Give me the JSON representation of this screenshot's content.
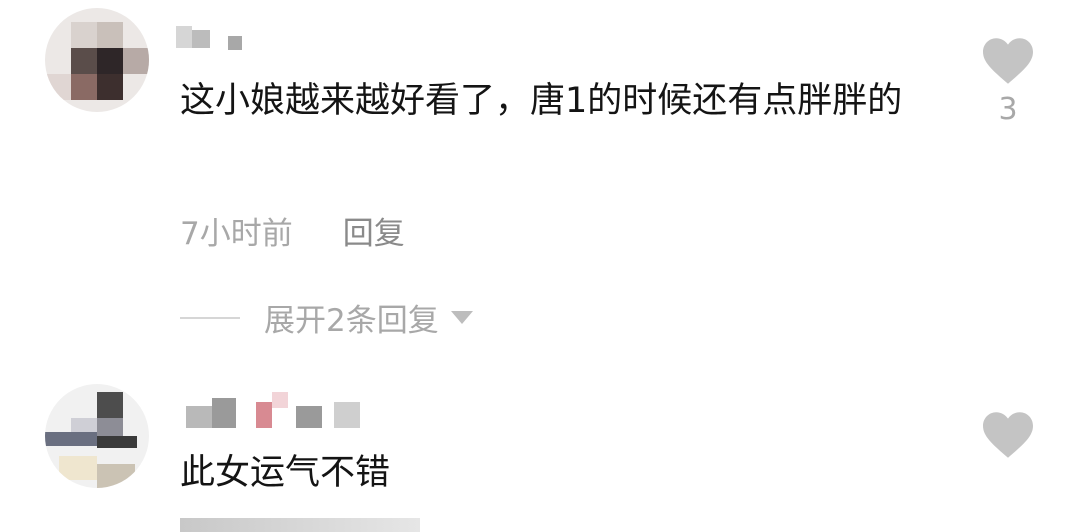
{
  "comments": [
    {
      "text": "这小娘越来越好看了，唐1的时候还有点胖胖的",
      "time": "7小时前",
      "reply_label": "回复",
      "like_count": "3",
      "expand_label": "展开2条回复"
    },
    {
      "text": "此女运气不错",
      "like_count": ""
    }
  ],
  "icons": {
    "like": "heart-icon",
    "expand": "caret-down-icon"
  },
  "colors": {
    "text": "#141414",
    "muted": "#a8a8a8",
    "heart": "#c4c4c4"
  }
}
